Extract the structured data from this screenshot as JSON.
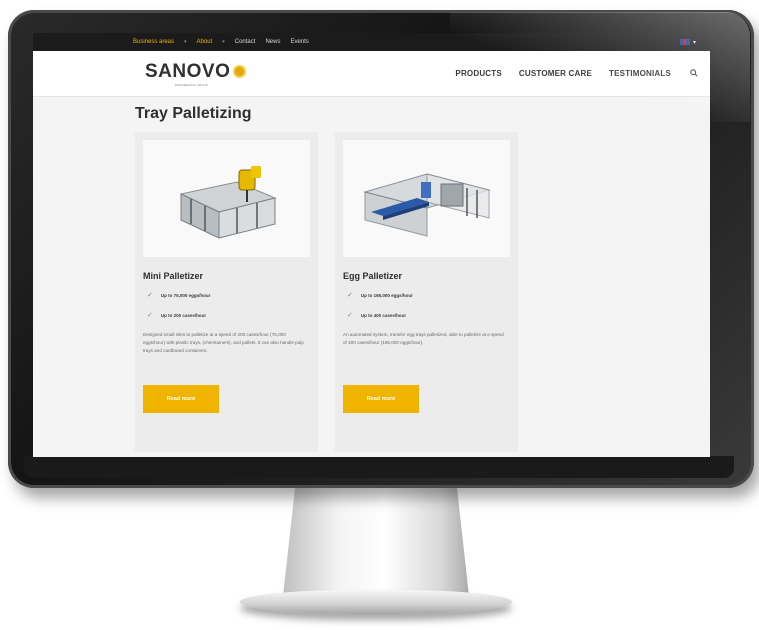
{
  "topbar": {
    "business_areas": "Business areas",
    "about": "About",
    "contact": "Contact",
    "news": "News",
    "events": "Events",
    "separator": "▾",
    "language_caret": "▾"
  },
  "header": {
    "logo_text": "SANOVO",
    "logo_tagline": "ENGINEERING GROUP",
    "nav": [
      "PRODUCTS",
      "CUSTOMER CARE",
      "TESTIMONIALS"
    ],
    "search_icon": "search-icon"
  },
  "main": {
    "title": "Tray Palletizing",
    "cards": [
      {
        "title": "Mini Palletizer",
        "features": [
          "Up to 75,000 eggs/hour",
          "Up to 200 cases/hour"
        ],
        "description": "Designed small sites to palletize at a speed of 200 cases/hour (75,000 eggs/hour) with plastic trays, (chemtainers), and pallets. It can also handle pulp trays and cardboard containers.",
        "button": "Read more"
      },
      {
        "title": "Egg Palletizer",
        "features": [
          "Up to 165,000 eggs/hour",
          "Up to 400 cases/hour"
        ],
        "description": "An automated system, transfer egg trays palletized, able to palletize at a speed of 400 cases/hour (165,000 eggs/hour).",
        "button": "Read more"
      }
    ]
  },
  "colors": {
    "accent": "#efb300",
    "topbar_bg": "#1b1b1b",
    "card_bg": "#ececec"
  }
}
